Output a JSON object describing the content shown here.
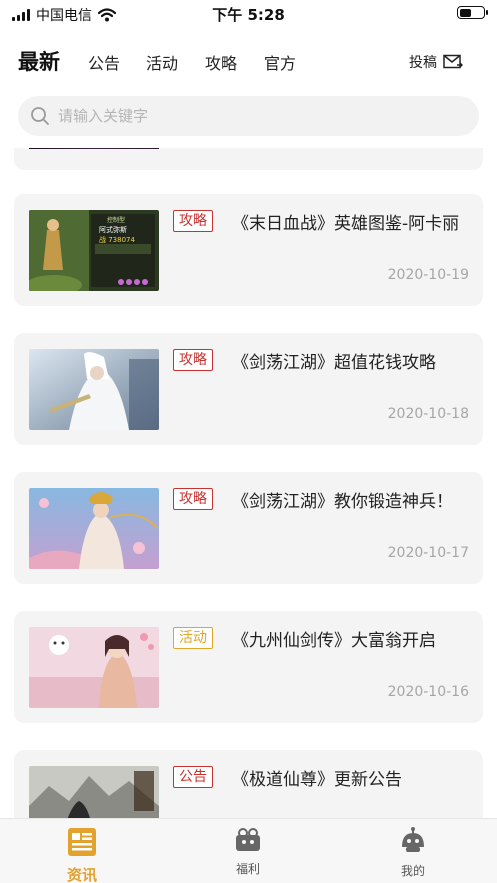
{
  "status": {
    "carrier": "中国电信",
    "time": "下午 5:28",
    "battery_level": 0.5
  },
  "top_nav": {
    "tabs": [
      {
        "label": "最新",
        "active": true
      },
      {
        "label": "公告",
        "active": false
      },
      {
        "label": "活动",
        "active": false
      },
      {
        "label": "攻略",
        "active": false
      },
      {
        "label": "官方",
        "active": false
      }
    ],
    "submit_label": "投稿"
  },
  "search": {
    "placeholder": "请输入关键字"
  },
  "articles": [
    {
      "tag": "攻略",
      "title": "《末日血战》英雄图鉴-阿卡丽",
      "date": "2020-10-19"
    },
    {
      "tag": "攻略",
      "title": "《剑荡江湖》超值花钱攻略",
      "date": "2020-10-18"
    },
    {
      "tag": "攻略",
      "title": "《剑荡江湖》教你锻造神兵！",
      "date": "2020-10-17"
    },
    {
      "tag": "活动",
      "title": "《九州仙剑传》大富翁开启",
      "date": "2020-10-16"
    },
    {
      "tag": "公告",
      "title": "《极道仙尊》更新公告",
      "date": ""
    }
  ],
  "thumb_1_text": {
    "name": "阿式弥斯",
    "power": "战 738074",
    "badge": "控制型"
  },
  "bottom_tabs": [
    {
      "label": "资讯",
      "icon": "news-icon",
      "active": true
    },
    {
      "label": "福利",
      "icon": "gift-icon",
      "active": false
    },
    {
      "label": "我的",
      "icon": "profile-icon",
      "active": false
    }
  ],
  "colors": {
    "accent": "#e3a22e",
    "tag_red": "#c8322f",
    "tag_orange": "#e1a52a"
  }
}
